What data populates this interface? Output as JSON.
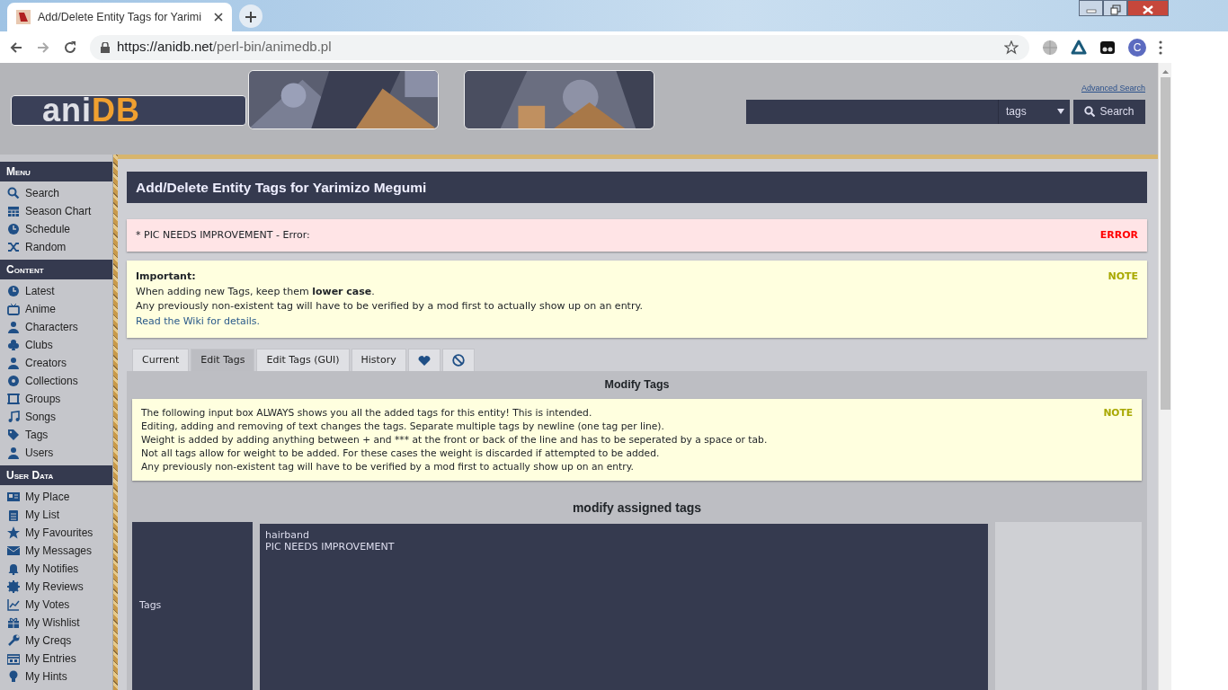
{
  "browser": {
    "tab_title": "Add/Delete Entity Tags for Yarimi",
    "url_host": "https://anidb.net",
    "url_path": "/perl-bin/animedb.pl",
    "profile_initial": "C"
  },
  "header": {
    "logo": "aniDB",
    "advanced_search": "Advanced Search",
    "search_type": "tags",
    "search_button": "Search"
  },
  "sidebar": [
    {
      "title": "Menu",
      "items": [
        "Search",
        "Season Chart",
        "Schedule",
        "Random"
      ]
    },
    {
      "title": "Content",
      "items": [
        "Latest",
        "Anime",
        "Characters",
        "Clubs",
        "Creators",
        "Collections",
        "Groups",
        "Songs",
        "Tags",
        "Users"
      ]
    },
    {
      "title": "User Data",
      "items": [
        "My Place",
        "My List",
        "My Favourites",
        "My Messages",
        "My Notifies",
        "My Reviews",
        "My Votes",
        "My Wishlist",
        "My Creqs",
        "My Entries",
        "My Hints"
      ]
    }
  ],
  "page_title": "Add/Delete Entity Tags for Yarimizo Megumi",
  "messages": [
    {
      "kind": "error",
      "lines": [
        "* PIC NEEDS IMPROVEMENT - Error:"
      ],
      "badge": "ERROR"
    },
    {
      "kind": "note",
      "heading": "Important:",
      "lines": [
        "When adding new Tags, keep them **lower case**.",
        "Any previously non-existent tag will have to be verified by a mod first to actually show up on an entry."
      ],
      "link": "Read the Wiki for details.",
      "badge": "NOTE"
    }
  ],
  "tabs": [
    {
      "kind": "text",
      "label": "Current",
      "selected": false
    },
    {
      "kind": "text",
      "label": "Edit Tags",
      "selected": true
    },
    {
      "kind": "text",
      "label": "Edit Tags (GUI)",
      "selected": false
    },
    {
      "kind": "text",
      "label": "History",
      "selected": false
    },
    {
      "kind": "heart",
      "selected": false
    },
    {
      "kind": "ban",
      "selected": false
    }
  ],
  "panel": {
    "title": "Modify Tags",
    "note": {
      "lines": [
        "The following input box ALWAYS shows you all the added tags for this entity! This is intended.",
        "Editing, adding and removing of text changes the tags. Separate multiple tags by newline (one tag per line).",
        "Weight is added by adding anything between + and *** at the front or back of the line and has to be seperated by a space or tab.",
        "Not all tags allow for weight to be added. For these cases the weight is discarded if attempted to be added.",
        "Any previously non-existent tag will have to be verified by a mod first to actually show up on an entry."
      ],
      "badge": "NOTE"
    },
    "section_title": "modify assigned tags",
    "field_label": "Tags",
    "field_value": "hairband\nPIC NEEDS IMPROVEMENT"
  }
}
